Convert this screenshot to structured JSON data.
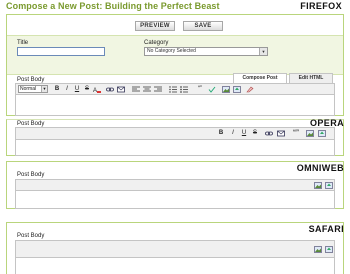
{
  "post_title": "Compose a New Post: Building the Perfect Beast",
  "browsers": {
    "firefox": "FIREFOX",
    "opera": "OPERA",
    "omniweb": "OMNIWEB",
    "safari": "SAFARI"
  },
  "actions": {
    "preview_label": "PREVIEW",
    "save_label": "SAVE"
  },
  "form": {
    "title_label": "Title",
    "title_value": "",
    "category_label": "Category",
    "category_value": "No Category Selected",
    "post_body_label": "Post Body"
  },
  "tabs": {
    "compose": "Compose Post",
    "edit_html": "Edit HTML"
  },
  "toolbar": {
    "font_size_value": "Normal",
    "bold": "B",
    "italic": "I",
    "underline": "U",
    "strike": "S",
    "quote": "“”"
  },
  "colors": {
    "title_green": "#7a9a2e",
    "panel_border": "#b9d57c",
    "meta_background": "#f1f6e2"
  }
}
